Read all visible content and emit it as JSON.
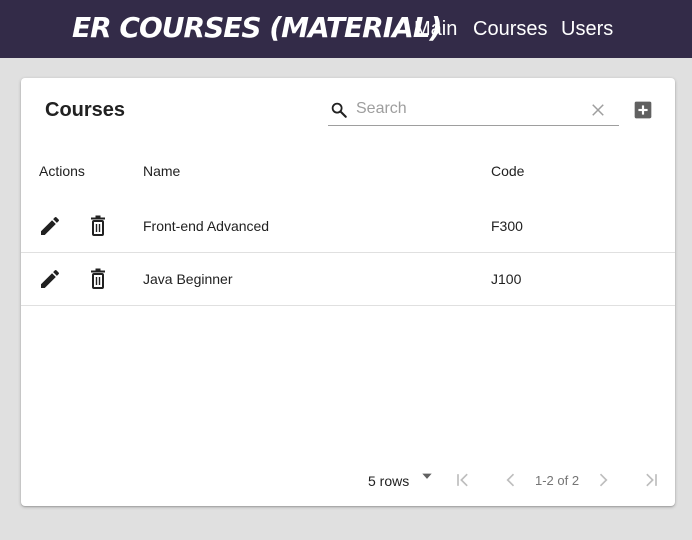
{
  "appbar": {
    "brand": "ER COURSES (MATERIAL)",
    "nav": [
      "Main",
      "Courses",
      "Users"
    ],
    "background": "#332b48"
  },
  "card": {
    "title": "Courses",
    "search": {
      "placeholder": "Search",
      "value": ""
    },
    "icons": {
      "search": "search-icon",
      "clear": "close-icon",
      "add": "add-box-icon",
      "edit": "pencil-icon",
      "delete": "trash-icon"
    },
    "columns": {
      "actions": "Actions",
      "name": "Name",
      "code": "Code"
    },
    "rows": [
      {
        "name": "Front-end Advanced",
        "code": "F300"
      },
      {
        "name": "Java Beginner",
        "code": "J100"
      }
    ],
    "pagination": {
      "rows_label": "5 rows",
      "page_info": "1-2 of 2"
    }
  }
}
